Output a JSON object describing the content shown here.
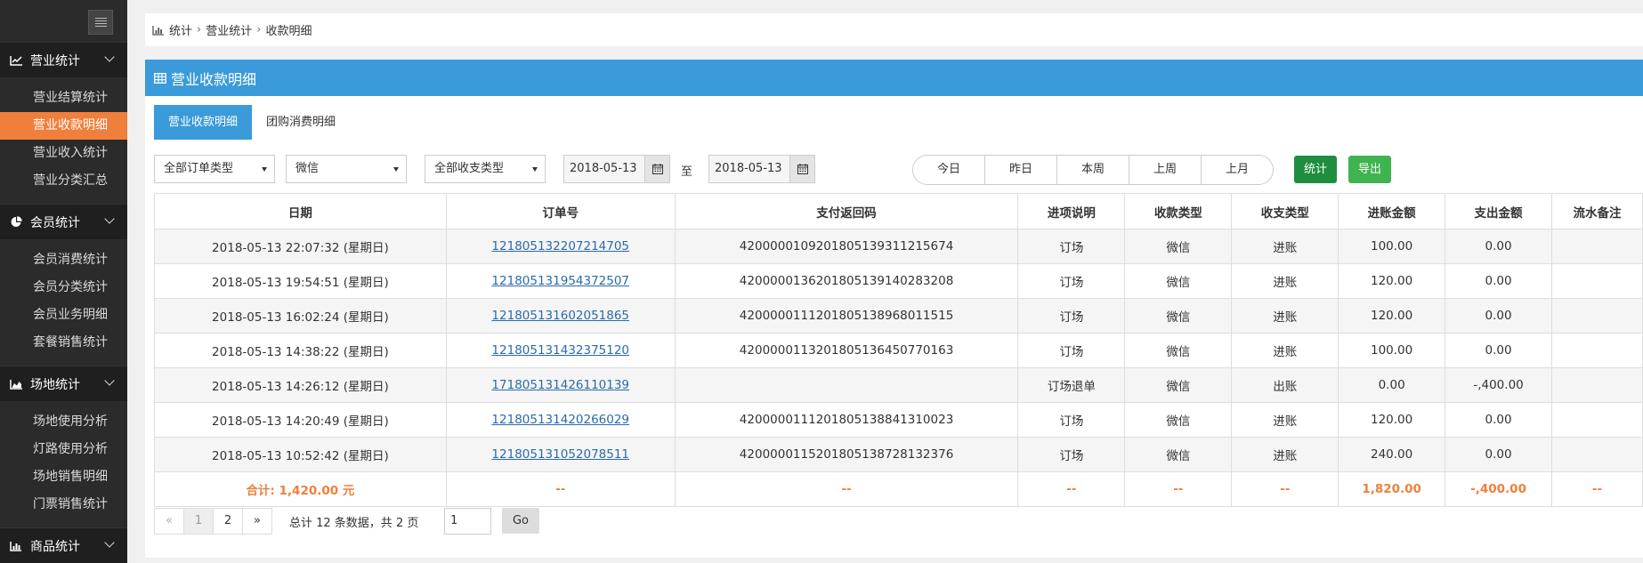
{
  "sidebar": {
    "sections": [
      {
        "title": "营业统计",
        "icon": "line-chart-icon",
        "items": [
          "营业结算统计",
          "营业收款明细",
          "营业收入统计",
          "营业分类汇总"
        ],
        "active": 1
      },
      {
        "title": "会员统计",
        "icon": "pie-chart-icon",
        "items": [
          "会员消费统计",
          "会员分类统计",
          "会员业务明细",
          "套餐销售统计"
        ],
        "active": -1
      },
      {
        "title": "场地统计",
        "icon": "area-chart-icon",
        "items": [
          "场地使用分析",
          "灯路使用分析",
          "场地销售明细",
          "门票销售统计"
        ],
        "active": -1
      },
      {
        "title": "商品统计",
        "icon": "bar-chart-icon",
        "items": [],
        "active": -1
      }
    ]
  },
  "breadcrumb": {
    "items": [
      "统计",
      "营业统计",
      "收款明细"
    ]
  },
  "panel": {
    "title": "营业收款明细"
  },
  "tabs": [
    "营业收款明细",
    "团购消费明细"
  ],
  "filters": {
    "order_type": "全部订单类型",
    "pay_method": "微信",
    "flow_type": "全部收支类型",
    "date_from": "2018-05-13",
    "date_to": "2018-05-13",
    "to_label": "至",
    "quick": [
      "今日",
      "昨日",
      "本周",
      "上周",
      "上月"
    ],
    "stat_label": "统计",
    "export_label": "导出"
  },
  "table": {
    "headers": [
      "日期",
      "订单号",
      "支付返回码",
      "进项说明",
      "收款类型",
      "收支类型",
      "进账金额",
      "支出金额",
      "流水备注"
    ],
    "rows": [
      [
        "2018-05-13 22:07:32 (星期日)",
        "121805132207214705",
        "4200000109201805139311215674",
        "订场",
        "微信",
        "进账",
        "100.00",
        "0.00",
        ""
      ],
      [
        "2018-05-13 19:54:51 (星期日)",
        "121805131954372507",
        "4200000136201805139140283208",
        "订场",
        "微信",
        "进账",
        "120.00",
        "0.00",
        ""
      ],
      [
        "2018-05-13 16:02:24 (星期日)",
        "121805131602051865",
        "4200000111201805138968011515",
        "订场",
        "微信",
        "进账",
        "120.00",
        "0.00",
        ""
      ],
      [
        "2018-05-13 14:38:22 (星期日)",
        "121805131432375120",
        "4200000113201805136450770163",
        "订场",
        "微信",
        "进账",
        "100.00",
        "0.00",
        ""
      ],
      [
        "2018-05-13 14:26:12 (星期日)",
        "171805131426110139",
        "",
        "订场退单",
        "微信",
        "出账",
        "0.00",
        "-,400.00",
        ""
      ],
      [
        "2018-05-13 14:20:49 (星期日)",
        "121805131420266029",
        "4200000111201805138841310023",
        "订场",
        "微信",
        "进账",
        "120.00",
        "0.00",
        ""
      ],
      [
        "2018-05-13 10:52:42 (星期日)",
        "121805131052078511",
        "4200000115201805138728132376",
        "订场",
        "微信",
        "进账",
        "240.00",
        "0.00",
        ""
      ]
    ],
    "total": [
      "合计: 1,420.00 元",
      "--",
      "--",
      "--",
      "--",
      "--",
      "1,820.00",
      "-,400.00",
      "--"
    ]
  },
  "pager": {
    "prev": "«",
    "pages": [
      "1",
      "2"
    ],
    "next": "»",
    "info": "总计 12 条数据，共 2 页",
    "input_value": "1",
    "go_label": "Go"
  }
}
